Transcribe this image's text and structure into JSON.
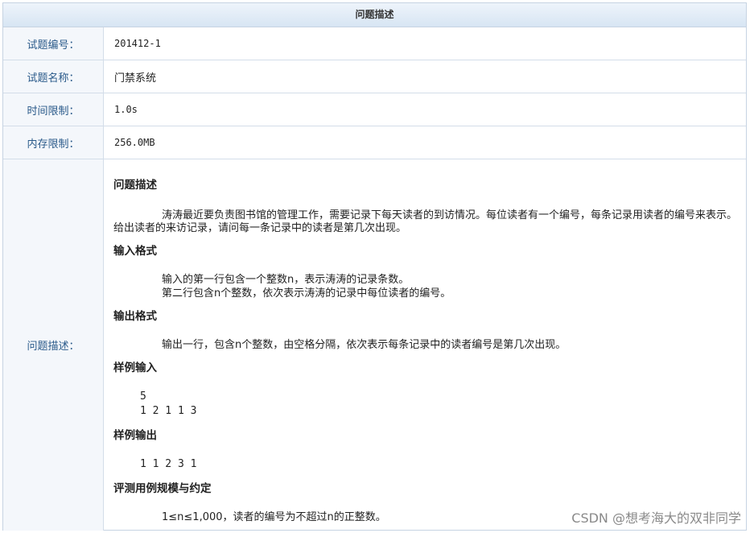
{
  "header": {
    "title": "问题描述"
  },
  "rows": [
    {
      "label": "试题编号：",
      "value": "201412-1"
    },
    {
      "label": "试题名称：",
      "value": "门禁系统"
    },
    {
      "label": "时间限制：",
      "value": "1.0s"
    },
    {
      "label": "内存限制：",
      "value": "256.0MB"
    }
  ],
  "desc_label": "问题描述：",
  "problem": {
    "desc_title": "问题描述",
    "desc_text": "涛涛最近要负责图书馆的管理工作，需要记录下每天读者的到访情况。每位读者有一个编号，每条记录用读者的编号来表示。给出读者的来访记录，请问每一条记录中的读者是第几次出现。",
    "input_title": "输入格式",
    "input_line1": "输入的第一行包含一个整数n，表示涛涛的记录条数。",
    "input_line2": "第二行包含n个整数，依次表示涛涛的记录中每位读者的编号。",
    "output_title": "输出格式",
    "output_text": "输出一行，包含n个整数，由空格分隔，依次表示每条记录中的读者编号是第几次出现。",
    "sample_in_title": "样例输入",
    "sample_in_line1": "5",
    "sample_in_line2": "1 2 1 1 3",
    "sample_out_title": "样例输出",
    "sample_out": "1 1 2 3 1",
    "scale_title": "评测用例规模与约定",
    "scale_text": "1≤n≤1,000，读者的编号为不超过n的正整数。"
  },
  "watermark": "CSDN @想考海大的双非同学"
}
